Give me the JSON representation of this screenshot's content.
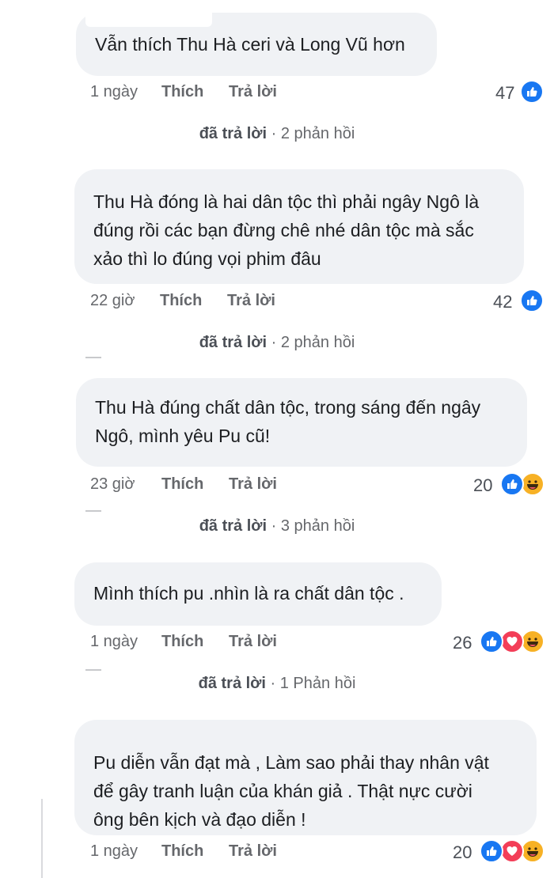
{
  "comments": [
    {
      "lines": [
        "Vẫn thích Thu Hà ceri và Long Vũ hơn"
      ],
      "time": "1 ngày",
      "like": "Thích",
      "reply": "Trả lời",
      "count": "47",
      "reactions": [
        "like"
      ],
      "replies": {
        "who": "đã trả lời",
        "sep": " · ",
        "count": "2 phản hồi"
      }
    },
    {
      "lines": [
        "Thu Hà đóng là hai dân tộc thì phải ngây Ngô là",
        "đúng rồi các bạn đừng chê nhé dân tộc mà sắc",
        "xảo thì lo đúng vọi phim đâu"
      ],
      "time": "22 giờ",
      "like": "Thích",
      "reply": "Trả lời",
      "count": "42",
      "reactions": [
        "like"
      ],
      "replies": {
        "who": "đã trả lời",
        "sep": " · ",
        "count": "2 phản hồi"
      }
    },
    {
      "lines": [
        "Thu Hà đúng chất dân tộc, trong sáng đến ngây",
        "Ngô, mình yêu Pu cũ!"
      ],
      "time": "23 giờ",
      "like": "Thích",
      "reply": "Trả lời",
      "count": "20",
      "reactions": [
        "like",
        "haha"
      ],
      "replies": {
        "who": "đã trả lời",
        "sep": " · ",
        "count": "3 phản hồi"
      }
    },
    {
      "lines": [
        "Mình thích pu .nhìn là ra chất dân tộc ."
      ],
      "time": "1 ngày",
      "like": "Thích",
      "reply": "Trả lời",
      "count": "26",
      "reactions": [
        "like",
        "love",
        "haha"
      ],
      "replies": {
        "who": "đã trả lời",
        "sep": " · ",
        "count": "1 Phản hồi"
      }
    },
    {
      "lines": [
        "Pu diễn vẫn đạt mà  , Làm sao phải thay nhân vật",
        "để gây tranh luận của khán giả   . Thật nực cười",
        "ông bên kịch và đạo diễn  !"
      ],
      "time": "1 ngày",
      "like": "Thích",
      "reply": "Trả lời",
      "count": "20",
      "reactions": [
        "like",
        "love",
        "haha"
      ],
      "replies": null
    }
  ],
  "colors": {
    "like": "#1877f2",
    "love": "#f33e58",
    "haha": "#f7b125",
    "bubble": "#f0f2f5",
    "meta": "#65676b"
  },
  "icons": {
    "like": "thumbs-up-icon",
    "love": "heart-icon",
    "haha": "laughing-face-icon"
  }
}
